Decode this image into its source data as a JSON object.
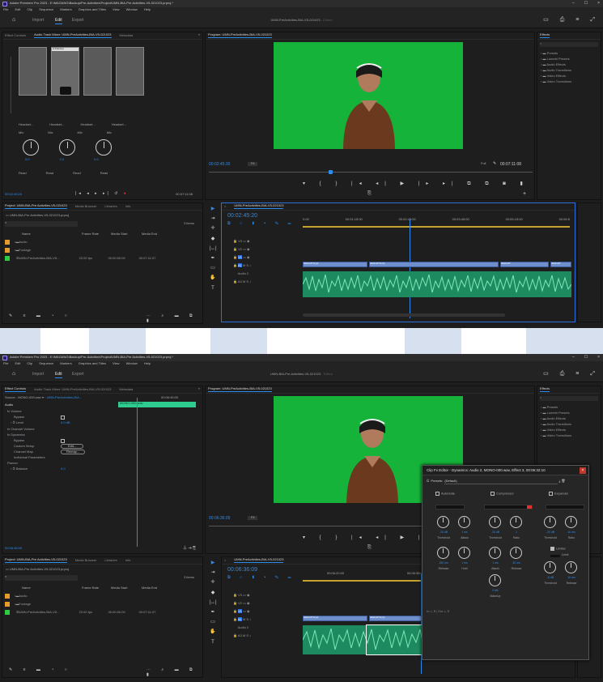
{
  "app": {
    "title_shot1": "Adobe Premiere Pro 2023 - E:\\MAGANG\\Backup\\Pre-Activities\\Project\\UMN-BIA-Pre Activities-V5-021023.prproj *",
    "title_shot2": "Adobe Premiere Pro 2023 - E:\\MAGANG\\Backup\\Pre-Activities\\Project\\UMN-BIA-Pre Activities-V5-021023.prproj *",
    "window_controls": [
      "–",
      "☐",
      "×"
    ]
  },
  "menu": [
    "File",
    "Edit",
    "Clip",
    "Sequence",
    "Markers",
    "Graphics and Titles",
    "View",
    "Window",
    "Help"
  ],
  "workspace": {
    "tabs": [
      "Import",
      "Edit",
      "Export"
    ],
    "active": "Edit",
    "project_title_shot1": "UMN-PreActivities-BIA-V5-021023",
    "project_title_shot2": "UMN-BIA-Pre Activities-V5-021023",
    "edited_label": "- Edited"
  },
  "shot1": {
    "left_tabs": [
      "Effect Controls",
      "Audio Track Mixer: UMN-PreActivities-BIA-V5-021023",
      "Metadata"
    ],
    "mixer": {
      "dropdown": "A Dokuwa",
      "read_labels": [
        "Read",
        "Read",
        "Read",
        "Read"
      ],
      "track_labels": [
        "Headset...",
        "Headset...",
        "Headset...",
        "Headset..."
      ],
      "mix_labels": [
        "Mix",
        "Mix",
        "Mix",
        "Mix"
      ],
      "knob_values": [
        "0.0",
        "0.0",
        "0.0",
        "0.0"
      ],
      "timecode_left": "00:02:45:20",
      "timecode_right": "00:07:11:08"
    },
    "program": {
      "tab": "Program: UMN-PreActivities-BIA-V5-021023",
      "timecode": "00:02:45:30",
      "fit": "Fit",
      "zoom": "Full",
      "duration": "00:07:11:08"
    },
    "effects": {
      "tab": "Effects",
      "items": [
        "Presets",
        "Lumetri Presets",
        "Audio Effects",
        "Audio Transitions",
        "Video Effects",
        "Video Transitions"
      ]
    },
    "project": {
      "tabs": [
        "Project: UMN-BIA-Pre Activities-V5-021023",
        "Media Browser",
        "Libraries",
        "Info"
      ],
      "file": "UMN-BIA-Pre Activities-V5-021023.prproj",
      "count": "3 items",
      "columns": [
        "Name",
        "Frame Rate",
        "Media Start",
        "Media End"
      ],
      "rows": [
        {
          "name": "Audio",
          "rate": "",
          "start": "",
          "end": "",
          "color": "#e69c2b"
        },
        {
          "name": "Footage",
          "rate": "",
          "start": "",
          "end": "",
          "color": "#e69c2b"
        },
        {
          "name": "UMN-PreActivities-BIA-V5...",
          "rate": "23.00 fps",
          "start": "00:00:00:00",
          "end": "00:07:11:07",
          "color": "#2ecc40"
        }
      ]
    },
    "timeline": {
      "tab": "UMN-PreActivities-BIA-V5-021023",
      "timecode": "00:02:45:20",
      "ruler": [
        "0:00",
        "00:01:15:00",
        "00:02:45:00",
        "00:03:45:00",
        "00:05:15:00",
        "00:06:5"
      ],
      "tracks": [
        "V3",
        "V2",
        "V1",
        "A1",
        "A2",
        "A3"
      ],
      "audio_label": "Audio 2",
      "clips_v": [
        "0000.MTS [V]",
        "0000.MTS [V]",
        "0000.MT",
        "0000.MT"
      ]
    }
  },
  "shot2": {
    "left_tabs": [
      "Effect Controls",
      "Audio Track Mixer: UMN-PreActivities-BIA-V5-021023",
      "Metadata"
    ],
    "source": "Source - MONO-000.wav",
    "seq": "UMN-PreActivities-BIA...",
    "clip_name": "MONO-000.wav",
    "time_top": "00:06:45:00",
    "section": "Audio",
    "params": [
      {
        "label": "fx Volume",
        "value": ""
      },
      {
        "label": "Bypass",
        "value": ""
      },
      {
        "label": "Level",
        "value": "0.0 dB"
      },
      {
        "label": "fx Channel Volume",
        "value": ""
      },
      {
        "label": "fx Dynamics",
        "value": ""
      },
      {
        "label": "Bypass",
        "value": ""
      },
      {
        "label": "Custom Setup",
        "value": "Edit..."
      },
      {
        "label": "Channel Map",
        "value": "Remap..."
      },
      {
        "label": "Individual Parameters",
        "value": ""
      },
      {
        "label": "Panner",
        "value": ""
      },
      {
        "label": "Balance",
        "value": "0.0"
      }
    ],
    "ec_timecode": "00:06:36:09",
    "program": {
      "tab": "Program: UMN-PreActivities-BIA-V5-021023",
      "timecode": "00:06:36:09",
      "fit": "Fit"
    },
    "effects_items": [
      "Presets",
      "Lumetri Presets",
      "Audio Effects",
      "Audio Transitions",
      "Video Effects",
      "Video Transitions"
    ],
    "dialog": {
      "title": "Clip Fx Editor - Dynamics: Audio 2, MONO-000.wav, Effect 3, 00:06:32:10",
      "presets_label": "Presets:",
      "preset_value": "(Default)",
      "sections": [
        "AutoGate",
        "Compressor",
        "Expander"
      ],
      "row1_values": [
        "-20 dB",
        "1 ms",
        "-20 dB",
        "1",
        "-20 dB",
        "10 ms"
      ],
      "row1_labels": [
        "Threshold",
        "Attack",
        "Threshold",
        "Ratio",
        "Threshold",
        "Ratio"
      ],
      "row2_values": [
        "150 ms",
        "1 ms",
        "1 ms",
        "30 ms",
        "-6 dB",
        "10 ms"
      ],
      "row2_labels": [
        "Release",
        "Hold",
        "Attack",
        "Release",
        "Threshold",
        "Release"
      ],
      "limiter": "Limiter",
      "limit_label": "Limit",
      "makeup_value": "0 dB",
      "makeup_label": "MakeUp",
      "footer": "In: L, R | Out: L, R"
    },
    "project": {
      "tabs": [
        "Project: UMN-BIA-Pre Activities-V5-021023",
        "Media Browser",
        "Libraries",
        "Info"
      ],
      "file": "UMN-BIA-Pre Activities-V5-021023.prproj",
      "count": "3 items",
      "columns": [
        "Name",
        "Frame Rate",
        "Media Start",
        "Media End"
      ],
      "rows": [
        {
          "name": "Audio",
          "rate": "",
          "start": "",
          "end": "",
          "color": "#e69c2b"
        },
        {
          "name": "Footage",
          "rate": "",
          "start": "",
          "end": "",
          "color": "#e69c2b"
        },
        {
          "name": "UMN-PreActivities-BIA-V5...",
          "rate": "23.00 fps",
          "start": "00:00:00:00",
          "end": "00:07:11:07",
          "color": "#2ecc40"
        }
      ]
    },
    "timeline": {
      "tab": "UMN-PreActivities-BIA-V5-021023",
      "timecode": "00:06:36:09",
      "ruler": [
        "00:06:20:00",
        "00:06:35:00"
      ],
      "clips_v": [
        "0000.MTS [V]",
        "0000.MTS [V]"
      ]
    }
  },
  "colors": {
    "accent": "#2d8ceb",
    "green_screen": "#15b33a",
    "audio_clip": "#1e8a60",
    "video_clip": "#6e8fcc"
  }
}
